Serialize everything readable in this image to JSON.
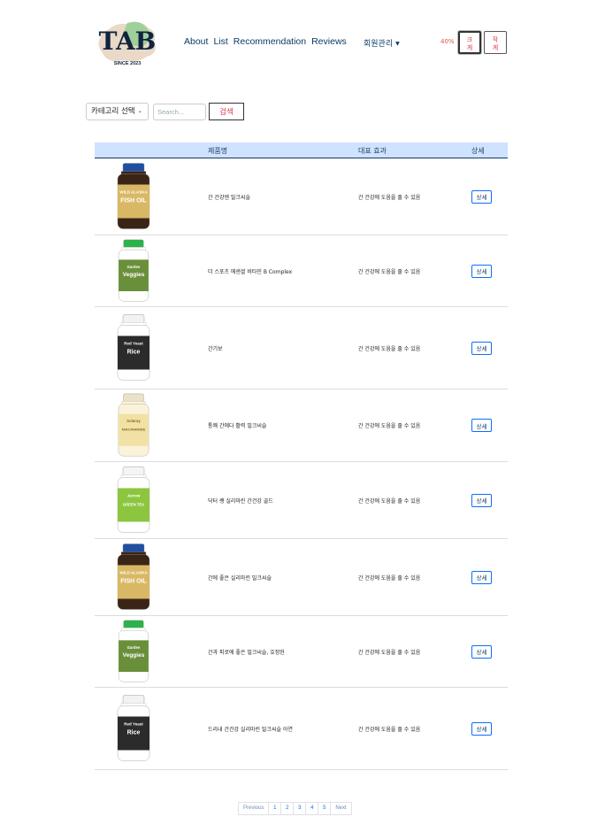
{
  "header": {
    "logo_text": "TAB",
    "logo_sub": "SINCE 2023",
    "nav": [
      "About",
      "List",
      "Recommendation",
      "Reviews"
    ],
    "member_menu": "회원관리",
    "zoom_level": "40%",
    "font_buttons": [
      {
        "top": "크",
        "bottom": "게"
      },
      {
        "top": "작",
        "bottom": "게"
      }
    ]
  },
  "filter": {
    "category_select": "카테고리 선택",
    "search_placeholder": "Search...",
    "search_button": "검색"
  },
  "table": {
    "columns": [
      "제품명",
      "대표 효과",
      "상세"
    ],
    "rows": [
      {
        "name": "간 건강엔 밀크씨슬",
        "effect": "간 건강에 도움을 줄 수 있음",
        "detail": "상세",
        "image": "fish-oil-bottle"
      },
      {
        "name": "더 스포츠 에센셜 비타민 B Complex",
        "effect": "간 건강에 도움을 줄 수 있음",
        "detail": "상세",
        "image": "garden-veggies-bottle"
      },
      {
        "name": "간기보",
        "effect": "간 건강에 도움을 줄 수 있음",
        "detail": "상세",
        "image": "red-yeast-rice-bottle"
      },
      {
        "name": "통쾌 간에다 활력 밀크씨슬",
        "effect": "간 건강에 도움을 줄 수 있음",
        "detail": "상세",
        "image": "niacinamide-bottle"
      },
      {
        "name": "닥터 쌩 실리마린 간건강 골드",
        "effect": "간 건강에 도움을 줄 수 있음",
        "detail": "상세",
        "image": "green-tea-bottle"
      },
      {
        "name": "간에 좋은 실리마린 밀크씨슬",
        "effect": "간 건강에 도움을 줄 수 있음",
        "detail": "상세",
        "image": "fish-oil-bottle"
      },
      {
        "name": "간과 피로에 좋은 밀크씨슬, 호정헌",
        "effect": "간 건강에 도움을 줄 수 있음",
        "detail": "상세",
        "image": "garden-veggies-bottle"
      },
      {
        "name": "드리내 간건강 실리마린 밀크씨슬 아연",
        "effect": "간 건강에 도움을 줄 수 있음",
        "detail": "상세",
        "image": "red-yeast-rice-bottle"
      }
    ]
  },
  "product_images": {
    "fish-oil-bottle": {
      "label_top": "WILD ALASKA",
      "label_main": "FISH OIL",
      "colors": {
        "body": "#3a2416",
        "cap": "#1e4fa3",
        "label": "#d9b865",
        "text": "#ffffff"
      }
    },
    "garden-veggies-bottle": {
      "label_top": "Garden",
      "label_main": "Veggies",
      "colors": {
        "body": "#ffffff",
        "cap": "#2bb34a",
        "label": "#6a8f3a",
        "text": "#ffffff"
      }
    },
    "red-yeast-rice-bottle": {
      "label_top": "Red Yeast",
      "label_main": "Rice",
      "colors": {
        "body": "#ffffff",
        "cap": "#f2f2f2",
        "label": "#2b2b2b",
        "text": "#ffffff"
      }
    },
    "niacinamide-bottle": {
      "label_top": "Solaray",
      "label_main": "NIACINAMIDE",
      "colors": {
        "body": "#fbf3d9",
        "cap": "#eae2c6",
        "label": "#f1e1a6",
        "text": "#8a6b1e"
      }
    },
    "green-tea-bottle": {
      "label_top": "Jarrow",
      "label_main": "GREEN TEA",
      "colors": {
        "body": "#ffffff",
        "cap": "#f4f4f4",
        "label": "#8cc63f",
        "text": "#ffffff"
      }
    }
  },
  "pagination": {
    "previous": "Previous",
    "pages": [
      "1",
      "2",
      "3",
      "4",
      "5"
    ],
    "next": "Next"
  }
}
